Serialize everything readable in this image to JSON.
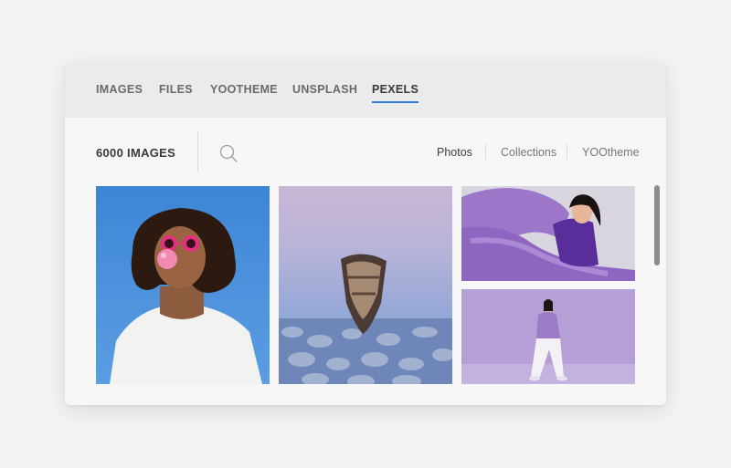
{
  "tabs": [
    {
      "label": "IMAGES",
      "active": false
    },
    {
      "label": "FILES",
      "active": false
    },
    {
      "label": "YOOTHEME",
      "active": false
    },
    {
      "label": "UNSPLASH",
      "active": false
    },
    {
      "label": "PEXELS",
      "active": true
    }
  ],
  "toolbar": {
    "count_label": "6000 IMAGES",
    "search_icon": "search-icon",
    "filters": [
      {
        "label": "Photos",
        "active": true
      },
      {
        "label": "Collections",
        "active": false
      },
      {
        "label": "YOOtheme",
        "active": false
      }
    ]
  },
  "colors": {
    "accent": "#2f7fd8",
    "background": "#f3f3f3",
    "panel": "#f7f7f7",
    "tabbar": "#ebebeb"
  },
  "images": [
    {
      "subject": "woman-bubblegum-pink-sunglasses"
    },
    {
      "subject": "rowboat-over-rocky-water"
    },
    {
      "subject": "woman-purple-fabric"
    },
    {
      "subject": "woman-walking-purple-background"
    }
  ]
}
